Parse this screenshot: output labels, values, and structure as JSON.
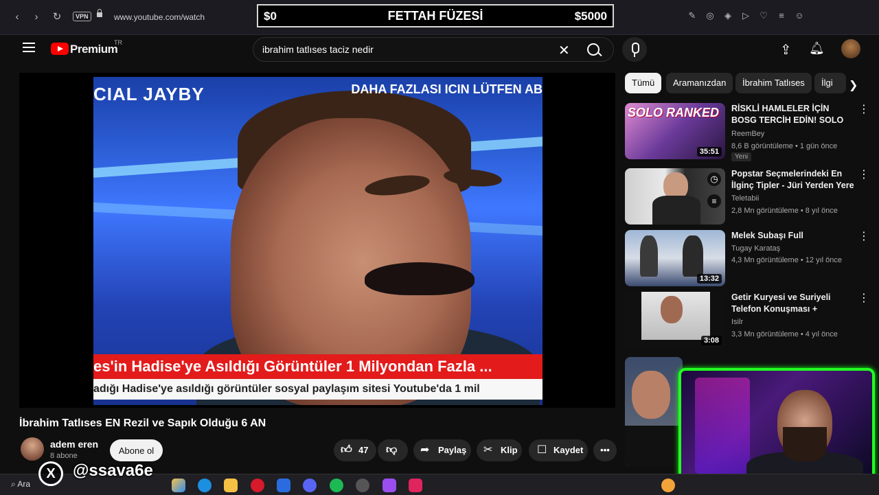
{
  "browser": {
    "url": "www.youtube.com/watch",
    "vpn_label": "VPN"
  },
  "banner": {
    "left": "$0",
    "center": "FETTAH FÜZESİ",
    "right": "$5000"
  },
  "header": {
    "brand": "Premium",
    "region": "TR",
    "search_value": "ibrahim tatlıses taciz nedir"
  },
  "video": {
    "caption_top_left": "CIAL JAYBY",
    "caption_top_right": "DAHA FAZLASI ICIN LÜTFEN AB",
    "caption_red": "es'in Hadise'ye Asıldığı Görüntüler 1 Milyondan Fazla ...",
    "caption_white": "adığı Hadise'ye asıldığı görüntüler sosyal paylaşım sitesi Youtube'da 1 mil",
    "title": "İbrahim Tatlıses EN Rezil ve Sapık Olduğu 6 AN",
    "channel": "adem eren",
    "subscribers": "8 abone",
    "subscribe_label": "Abone ol",
    "likes": "47",
    "share_label": "Paylaş",
    "clip_label": "Klip",
    "save_label": "Kaydet"
  },
  "chips": [
    "Tümü",
    "Aramanızdan",
    "İbrahim Tatlıses",
    "İlgi"
  ],
  "recommendations": [
    {
      "title": "RİSKLİ HAMLELER İÇİN BOSG TERCİH EDİN! SOLO RANKED ...",
      "channel": "ReemBey",
      "meta": "8,6 B görüntüleme • 1 gün önce",
      "duration": "35:51",
      "badge": "Yeni",
      "thumb_text": "SOLO RANKED"
    },
    {
      "title": "Popstar Seçmelerindeki En İlginç Tipler - Jüri Yerden Yere ...",
      "channel": "Teletabii",
      "meta": "2,8 Mn görüntüleme • 8 yıl önce",
      "duration": "",
      "badge": ""
    },
    {
      "title": "Melek Subaşı Full",
      "channel": "Tugay Karataş",
      "meta": "4,3 Mn görüntüleme • 12 yıl önce",
      "duration": "13:32",
      "badge": ""
    },
    {
      "title": "Getir Kuryesi ve Suriyeli Telefon Konuşması + whatsapp (uzun ...",
      "channel": "Isilr",
      "meta": "3,3 Mn görüntüleme • 4 yıl önce",
      "duration": "3:08",
      "badge": ""
    }
  ],
  "overlay": {
    "handle": "@ssava6e"
  },
  "taskbar": {
    "search_label": "Ara"
  },
  "colors": {
    "accent_red": "#ff0000",
    "cam_border": "#22ff22",
    "bg": "#0f0f0f"
  }
}
